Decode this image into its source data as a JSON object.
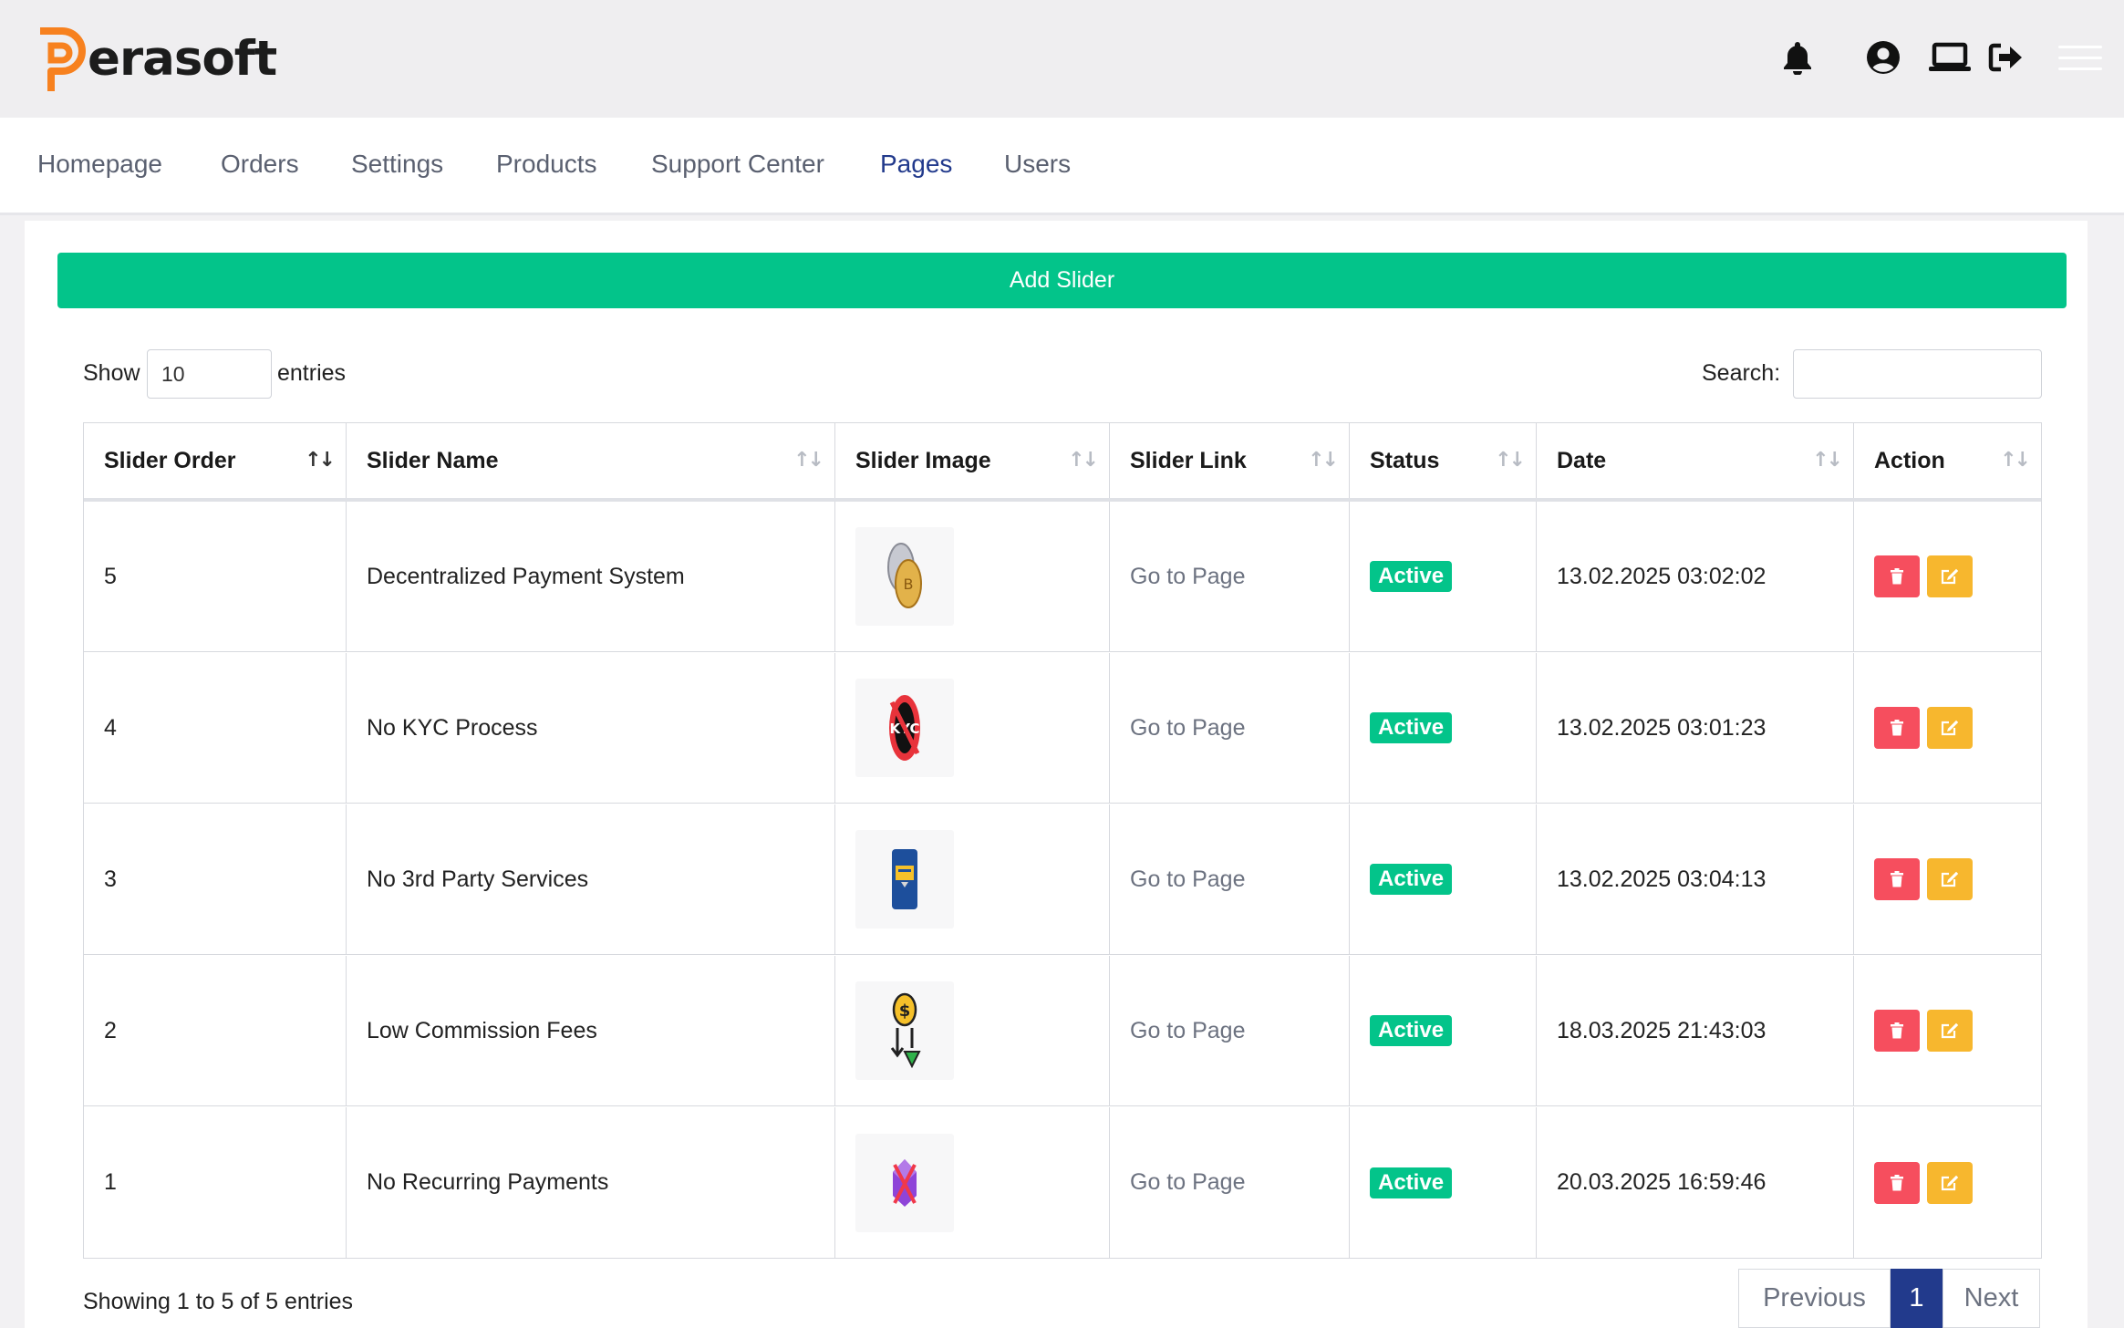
{
  "brand": {
    "name": "erasoft",
    "accent": "#f7811f"
  },
  "header": {
    "icons": [
      "bell-icon",
      "user-circle-icon",
      "laptop-icon",
      "logout-icon",
      "menu-icon"
    ]
  },
  "nav": {
    "items": [
      {
        "label": "Homepage"
      },
      {
        "label": "Orders"
      },
      {
        "label": "Settings"
      },
      {
        "label": "Products"
      },
      {
        "label": "Support Center"
      },
      {
        "label": "Pages",
        "active": true
      },
      {
        "label": "Users"
      }
    ]
  },
  "toolbar": {
    "add_label": "Add Slider"
  },
  "controls": {
    "show_label": "Show",
    "entries_value": "10",
    "entries_label": "entries",
    "search_label": "Search:",
    "search_value": ""
  },
  "table": {
    "columns": [
      "Slider Order",
      "Slider Name",
      "Slider Image",
      "Slider Link",
      "Status",
      "Date",
      "Action"
    ],
    "rows": [
      {
        "order": "5",
        "name": "Decentralized Payment System",
        "image": "coins-image",
        "link": "Go to Page",
        "status": "Active",
        "date": "13.02.2025 03:02:02"
      },
      {
        "order": "4",
        "name": "No KYC Process",
        "image": "no-kyc-image",
        "link": "Go to Page",
        "status": "Active",
        "date": "13.02.2025 03:01:23"
      },
      {
        "order": "3",
        "name": "No 3rd Party Services",
        "image": "card-reader-image",
        "link": "Go to Page",
        "status": "Active",
        "date": "13.02.2025 03:04:13"
      },
      {
        "order": "2",
        "name": "Low Commission Fees",
        "image": "dollar-arrows-image",
        "link": "Go to Page",
        "status": "Active",
        "date": "18.03.2025 21:43:03"
      },
      {
        "order": "1",
        "name": "No Recurring Payments",
        "image": "crossed-cube-image",
        "link": "Go to Page",
        "status": "Active",
        "date": "20.03.2025 16:59:46"
      }
    ]
  },
  "footer": {
    "info": "Showing 1 to 5 of 5 entries",
    "previous": "Previous",
    "page": "1",
    "next": "Next"
  },
  "colors": {
    "primary": "#03c48a",
    "danger": "#f64e5e",
    "warning": "#f7b72e",
    "nav_active": "#223a8c"
  }
}
